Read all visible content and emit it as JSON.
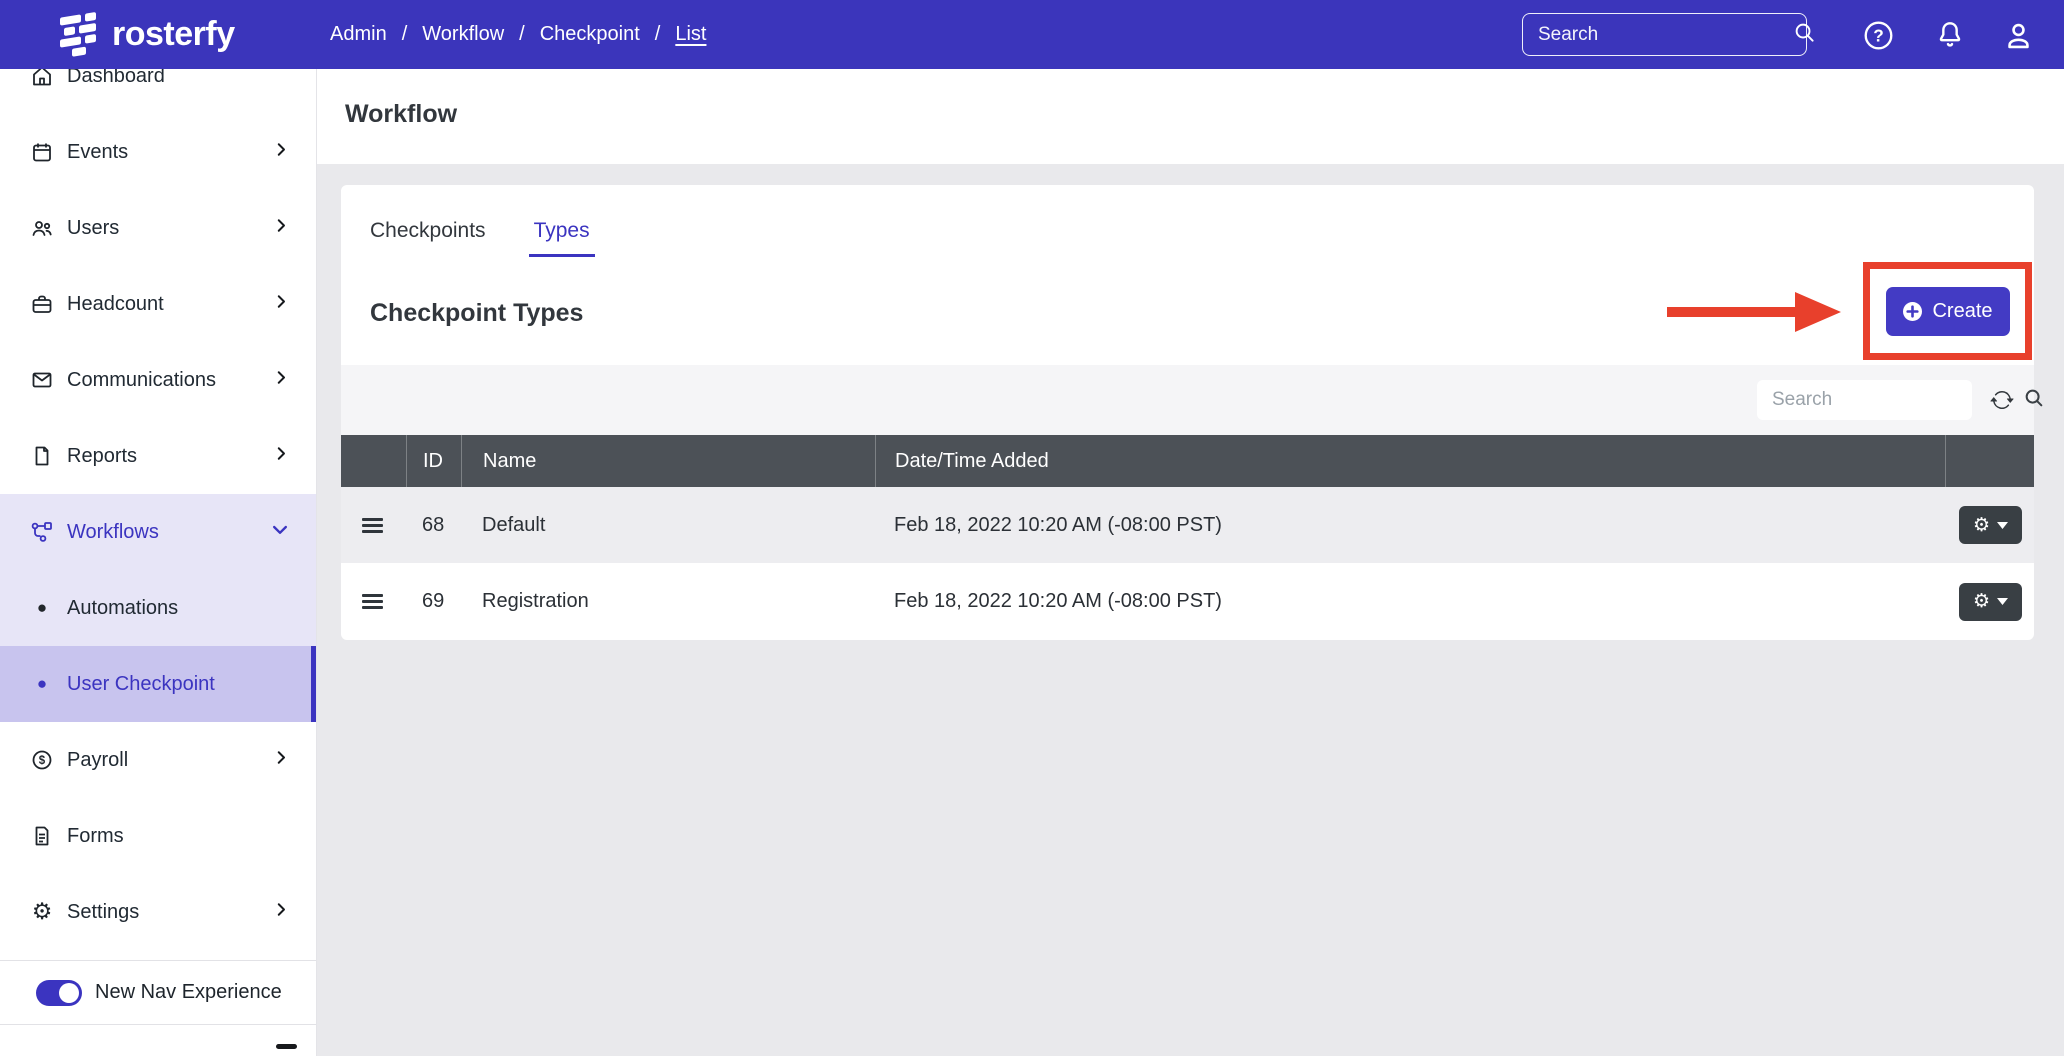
{
  "navbar": {
    "logo_text": "rosterfy",
    "sep": "/",
    "breadcrumb": [
      "Admin",
      "Workflow",
      "Checkpoint",
      "List"
    ],
    "search_placeholder": "Search"
  },
  "sidebar": {
    "items": [
      {
        "label": "Dashboard"
      },
      {
        "label": "Events"
      },
      {
        "label": "Users"
      },
      {
        "label": "Headcount"
      },
      {
        "label": "Communications"
      },
      {
        "label": "Reports"
      },
      {
        "label": "Workflows"
      },
      {
        "label": "Automations"
      },
      {
        "label": "User Checkpoint"
      },
      {
        "label": "Payroll"
      },
      {
        "label": "Forms"
      },
      {
        "label": "Settings"
      }
    ],
    "toggle_label": "New Nav Experience"
  },
  "page": {
    "title": "Workflow"
  },
  "tabs": [
    {
      "label": "Checkpoints",
      "active": false
    },
    {
      "label": "Types",
      "active": true
    }
  ],
  "section": {
    "heading": "Checkpoint Types",
    "create_label": "Create"
  },
  "table": {
    "search_placeholder": "Search",
    "columns": [
      "",
      "ID",
      "Name",
      "Date/Time Added",
      ""
    ],
    "rows": [
      {
        "id": "68",
        "name": "Default",
        "date": "Feb 18, 2022 10:20 AM (-08:00 PST)"
      },
      {
        "id": "69",
        "name": "Registration",
        "date": "Feb 18, 2022 10:20 AM (-08:00 PST)"
      }
    ]
  },
  "icons": {
    "navbar": [
      "rosterfy-mark",
      "magnifier",
      "question-circle",
      "bell",
      "person"
    ],
    "sidebar": [
      "home",
      "calendar",
      "people",
      "briefcase",
      "envelope",
      "file",
      "workflow-nodes",
      "dollar-circle",
      "file-text",
      "gear"
    ],
    "table": [
      "drag-handle",
      "gear",
      "caret-down",
      "refresh"
    ],
    "annotation": [
      "red-box",
      "red-arrow"
    ]
  },
  "colors": {
    "navbar_bg": "#3b35bb",
    "accent": "#3b34c0",
    "create_button": "#433bc4",
    "annotation_red": "#e8402c",
    "table_header_bg": "#4c5157",
    "row_alt_bg": "#ededf0",
    "page_bg": "#e9e9ec"
  }
}
